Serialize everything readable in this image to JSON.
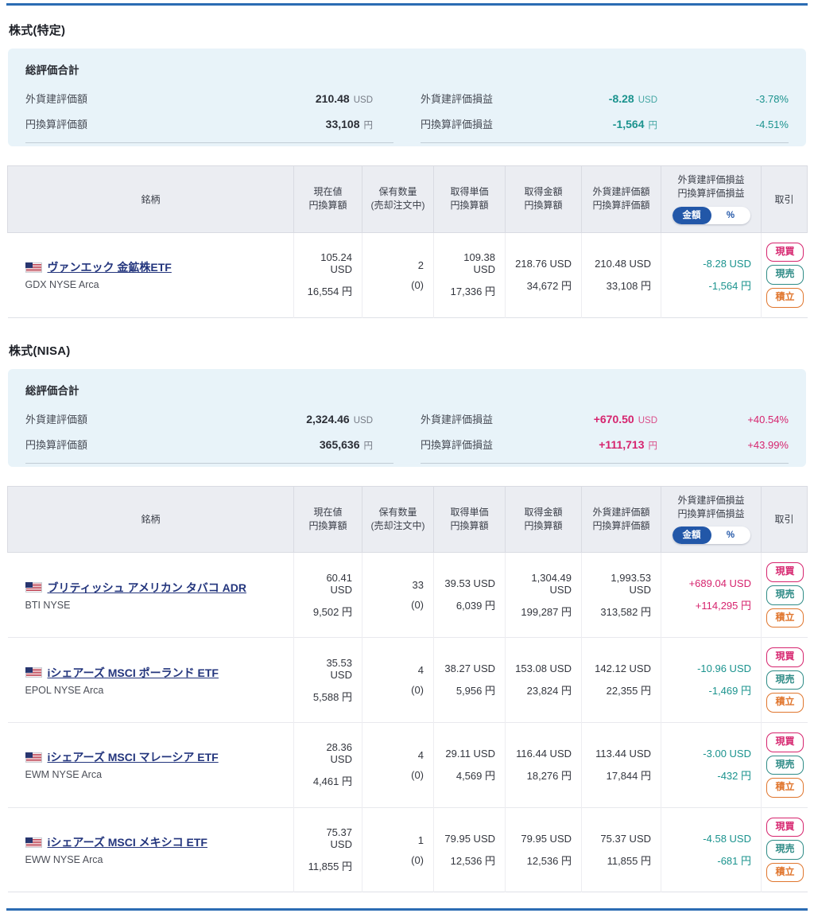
{
  "colors": {
    "rule_blue": "#2b6cb3",
    "negative_teal": "#1b938e",
    "positive_pink": "#d6246e",
    "toggle_blue": "#2257a8",
    "summary_bg": "#e8f3f9",
    "header_bg": "#ebedf2",
    "link_navy": "#23357d",
    "buy_pink": "#d6246e",
    "sell_teal": "#2e8b86",
    "accumulate_orange": "#e0762e"
  },
  "table_headers": {
    "name": "銘柄",
    "current": [
      "現在値",
      "円換算額"
    ],
    "quantity": [
      "保有数量",
      "(売却注文中)"
    ],
    "unit_cost": [
      "取得単価",
      "円換算額"
    ],
    "cost": [
      "取得金額",
      "円換算額"
    ],
    "valuation": [
      "外貨建評価額",
      "円換算評価額"
    ],
    "pl": [
      "外貨建評価損益",
      "円換算評価損益"
    ],
    "pl_toggle": [
      "金額",
      "%"
    ],
    "trade": "取引"
  },
  "trade_buttons": [
    {
      "label": "現買",
      "type": "buy"
    },
    {
      "label": "現売",
      "type": "sell"
    },
    {
      "label": "積立",
      "type": "accumulate"
    }
  ],
  "sections": [
    {
      "title": "株式(特定)",
      "summary": {
        "title": "総評価合計",
        "value_rows": [
          {
            "label": "外貨建評価額",
            "value": "210.48",
            "unit": "USD"
          },
          {
            "label": "円換算評価額",
            "value": "33,108",
            "unit": "円"
          }
        ],
        "pl_rows": [
          {
            "label": "外貨建評価損益",
            "value": "-8.28",
            "unit": "USD",
            "pct": "-3.78%",
            "tone": "negative"
          },
          {
            "label": "円換算評価損益",
            "value": "-1,564",
            "unit": "円",
            "pct": "-4.51%",
            "tone": "negative"
          }
        ]
      },
      "table": {
        "rows": [
          {
            "flag": "us-flag",
            "name": "ヴァンエック 金鉱株ETF",
            "ticker": "GDX NYSE Arca",
            "current": [
              "105.24 USD",
              "16,554 円"
            ],
            "quantity": [
              "2",
              "(0)"
            ],
            "unit_cost": [
              "109.38 USD",
              "17,336 円"
            ],
            "cost": [
              "218.76 USD",
              "34,672 円"
            ],
            "valuation": [
              "210.48 USD",
              "33,108 円"
            ],
            "pl": [
              "-8.28 USD",
              "-1,564 円"
            ],
            "pl_tone": "negative"
          }
        ]
      }
    },
    {
      "title": "株式(NISA)",
      "summary": {
        "title": "総評価合計",
        "value_rows": [
          {
            "label": "外貨建評価額",
            "value": "2,324.46",
            "unit": "USD"
          },
          {
            "label": "円換算評価額",
            "value": "365,636",
            "unit": "円"
          }
        ],
        "pl_rows": [
          {
            "label": "外貨建評価損益",
            "value": "+670.50",
            "unit": "USD",
            "pct": "+40.54%",
            "tone": "positive"
          },
          {
            "label": "円換算評価損益",
            "value": "+111,713",
            "unit": "円",
            "pct": "+43.99%",
            "tone": "positive"
          }
        ]
      },
      "table": {
        "rows": [
          {
            "flag": "us-flag",
            "name": "ブリティッシュ アメリカン タバコ ADR",
            "ticker": "BTI NYSE",
            "current": [
              "60.41 USD",
              "9,502 円"
            ],
            "quantity": [
              "33",
              "(0)"
            ],
            "unit_cost": [
              "39.53 USD",
              "6,039 円"
            ],
            "cost": [
              "1,304.49 USD",
              "199,287 円"
            ],
            "valuation": [
              "1,993.53 USD",
              "313,582 円"
            ],
            "pl": [
              "+689.04 USD",
              "+114,295 円"
            ],
            "pl_tone": "positive"
          },
          {
            "flag": "us-flag",
            "name": "iシェアーズ MSCI ポーランド ETF",
            "ticker": "EPOL NYSE Arca",
            "current": [
              "35.53 USD",
              "5,588 円"
            ],
            "quantity": [
              "4",
              "(0)"
            ],
            "unit_cost": [
              "38.27 USD",
              "5,956 円"
            ],
            "cost": [
              "153.08 USD",
              "23,824 円"
            ],
            "valuation": [
              "142.12 USD",
              "22,355 円"
            ],
            "pl": [
              "-10.96 USD",
              "-1,469 円"
            ],
            "pl_tone": "negative"
          },
          {
            "flag": "us-flag",
            "name": "iシェアーズ MSCI マレーシア ETF",
            "ticker": "EWM NYSE Arca",
            "current": [
              "28.36 USD",
              "4,461 円"
            ],
            "quantity": [
              "4",
              "(0)"
            ],
            "unit_cost": [
              "29.11 USD",
              "4,569 円"
            ],
            "cost": [
              "116.44 USD",
              "18,276 円"
            ],
            "valuation": [
              "113.44 USD",
              "17,844 円"
            ],
            "pl": [
              "-3.00 USD",
              "-432 円"
            ],
            "pl_tone": "negative"
          },
          {
            "flag": "us-flag",
            "name": "iシェアーズ MSCI メキシコ ETF",
            "ticker": "EWW NYSE Arca",
            "current": [
              "75.37 USD",
              "11,855 円"
            ],
            "quantity": [
              "1",
              "(0)"
            ],
            "unit_cost": [
              "79.95 USD",
              "12,536 円"
            ],
            "cost": [
              "79.95 USD",
              "12,536 円"
            ],
            "valuation": [
              "75.37 USD",
              "11,855 円"
            ],
            "pl": [
              "-4.58 USD",
              "-681 円"
            ],
            "pl_tone": "negative"
          }
        ]
      }
    }
  ]
}
